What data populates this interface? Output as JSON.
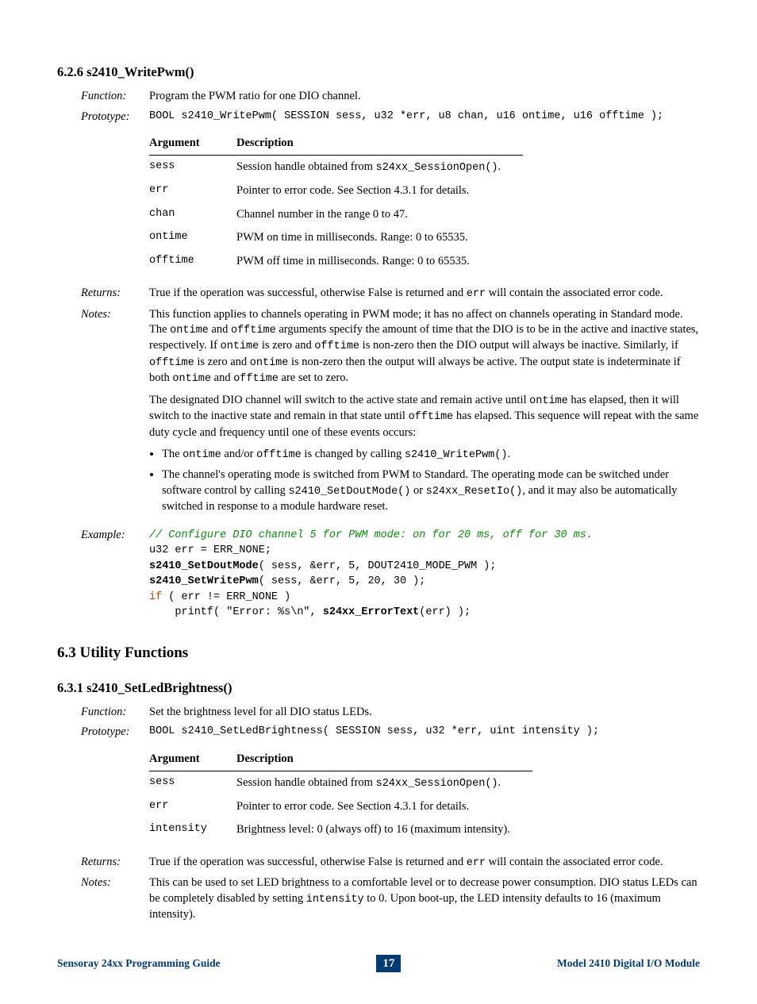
{
  "section626": {
    "heading": "6.2.6  s2410_WritePwm()",
    "function_label": "Function:",
    "function_text": "Program the PWM ratio for one DIO channel.",
    "prototype_label": "Prototype:",
    "prototype_code": "BOOL s2410_WritePwm( SESSION sess, u32 *err, u8 chan, u16 ontime, u16 offtime );",
    "table_head_arg": "Argument",
    "table_head_desc": "Description",
    "args": {
      "sess_name": "sess",
      "sess_desc_pre": "Session handle obtained from ",
      "sess_desc_code": "s24xx_SessionOpen()",
      "sess_desc_post": ".",
      "err_name": "err",
      "err_desc": "Pointer to error code. See Section 4.3.1 for details.",
      "chan_name": "chan",
      "chan_desc": "Channel number in the range 0 to 47.",
      "ontime_name": "ontime",
      "ontime_desc": "PWM on time in milliseconds. Range: 0 to 65535.",
      "offtime_name": "offtime",
      "offtime_desc": "PWM off time in milliseconds. Range: 0 to 65535."
    },
    "returns_label": "Returns:",
    "returns_pre": "True if the operation was successful, otherwise False is returned and ",
    "returns_code": "err",
    "returns_post": " will contain the associated error code.",
    "notes_label": "Notes:",
    "notes_p1_a": "This function applies to channels operating in PWM mode; it has no affect on channels operating in Standard mode. The ",
    "notes_p1_b": "ontime",
    "notes_p1_c": " and ",
    "notes_p1_d": "offtime",
    "notes_p1_e": " arguments specify the amount of time that the DIO is to be in the active and inactive states, respectively. If ",
    "notes_p1_f": "ontime",
    "notes_p1_g": " is zero and ",
    "notes_p1_h": "offtime",
    "notes_p1_i": " is non-zero then the DIO output will always be inactive. Similarly, if ",
    "notes_p1_j": "offtime",
    "notes_p1_k": " is zero and ",
    "notes_p1_l": "ontime",
    "notes_p1_m": " is non-zero then the output will always be active. The output state is indeterminate if both ",
    "notes_p1_n": "ontime",
    "notes_p1_o": " and ",
    "notes_p1_p": "offtime",
    "notes_p1_q": " are set to zero.",
    "notes_p2_a": "The designated DIO channel will switch to the active state and remain active until ",
    "notes_p2_b": "ontime",
    "notes_p2_c": " has elapsed, then it will switch to the inactive state and remain in that state until ",
    "notes_p2_d": "offtime",
    "notes_p2_e": " has elapsed. This sequence will repeat with the same duty cycle and frequency until one of these events occurs:",
    "bullet1_a": "The ",
    "bullet1_b": "ontime",
    "bullet1_c": " and/or ",
    "bullet1_d": "offtime",
    "bullet1_e": " is changed by calling ",
    "bullet1_f": "s2410_WritePwm()",
    "bullet1_g": ".",
    "bullet2_a": "The channel's operating mode is switched from PWM to Standard. The operating mode can be switched under software control by calling ",
    "bullet2_b": "s2410_SetDoutMode()",
    "bullet2_c": " or ",
    "bullet2_d": "s24xx_ResetIo()",
    "bullet2_e": ", and it may also be automatically switched in response to a module hardware reset.",
    "example_label": "Example:",
    "ex_comment": "// Configure DIO channel 5 for PWM mode: on for 20 ms, off for 30 ms.",
    "ex_l2": "u32 err = ERR_NONE;",
    "ex_l3_fn": "s2410_SetDoutMode",
    "ex_l3_rest": "( sess, &err, 5, DOUT2410_MODE_PWM );",
    "ex_l4_fn": "s2410_SetWritePwm",
    "ex_l4_rest": "( sess, &err, 5, 20, 30 );",
    "ex_l5_if": "if",
    "ex_l5_rest": " ( err != ERR_NONE )",
    "ex_l6_pre": "    printf( \"Error: %s\\n\", ",
    "ex_l6_fn": "s24xx_ErrorText",
    "ex_l6_post": "(err) );"
  },
  "section63": {
    "heading": "6.3  Utility Functions"
  },
  "section631": {
    "heading": "6.3.1  s2410_SetLedBrightness()",
    "function_label": "Function:",
    "function_text": "Set the brightness level for all DIO status LEDs.",
    "prototype_label": "Prototype:",
    "prototype_code": "BOOL s2410_SetLedBrightness( SESSION sess, u32 *err, uint intensity );",
    "table_head_arg": "Argument",
    "table_head_desc": "Description",
    "args": {
      "sess_name": "sess",
      "sess_desc_pre": "Session handle obtained from ",
      "sess_desc_code": "s24xx_SessionOpen()",
      "sess_desc_post": ".",
      "err_name": "err",
      "err_desc": "Pointer to error code. See Section 4.3.1 for details.",
      "intensity_name": "intensity",
      "intensity_desc": "Brightness level: 0 (always off) to 16 (maximum intensity)."
    },
    "returns_label": "Returns:",
    "returns_pre": "True if the operation was successful, otherwise False is returned and ",
    "returns_code": "err",
    "returns_post": " will contain the associated error code.",
    "notes_label": "Notes:",
    "notes_a": "This can be used to set LED brightness to a comfortable level or to decrease power consumption. DIO status LEDs can be completely disabled by setting ",
    "notes_b": "intensity",
    "notes_c": " to 0. Upon boot-up, the LED intensity defaults to 16 (maximum intensity)."
  },
  "footer": {
    "left": "Sensoray 24xx Programming Guide",
    "page": "17",
    "right": "Model 2410 Digital I/O Module"
  }
}
